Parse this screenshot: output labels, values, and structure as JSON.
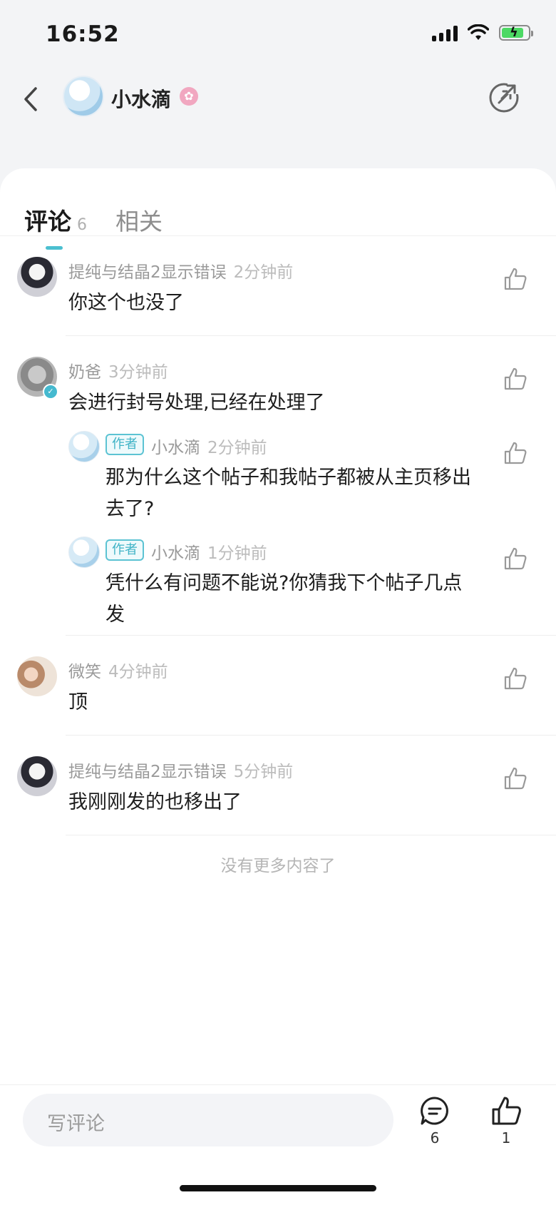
{
  "status_bar": {
    "time": "16:52"
  },
  "header": {
    "name": "小水滴"
  },
  "tabs": [
    {
      "label": "评论",
      "count": "6"
    },
    {
      "label": "相关"
    }
  ],
  "comments": [
    {
      "user": "提纯与结晶2显示错误",
      "time": "2分钟前",
      "text": "你这个也没了"
    },
    {
      "user": "奶爸",
      "time": "3分钟前",
      "text": "会进行封号处理,已经在处理了"
    },
    {
      "user": "微笑",
      "time": "4分钟前",
      "text": "顶"
    },
    {
      "user": "提纯与结晶2显示错误",
      "time": "5分钟前",
      "text": "我刚刚发的也移出了"
    }
  ],
  "replies": [
    {
      "tag": "作者",
      "user": "小水滴",
      "time": "2分钟前",
      "text": "那为什么这个帖子和我帖子都被从主页移出去了?"
    },
    {
      "tag": "作者",
      "user": "小水滴",
      "time": "1分钟前",
      "text": "凭什么有问题不能说?你猜我下个帖子几点发"
    }
  ],
  "footer_note": "没有更多内容了",
  "bottom_bar": {
    "input_placeholder": "写评论",
    "comment_count": "6",
    "like_count": "1"
  },
  "colors": {
    "accent": "#4bbfd0",
    "verified": "#45b9cf",
    "tag_border": "#5cc3d3"
  }
}
